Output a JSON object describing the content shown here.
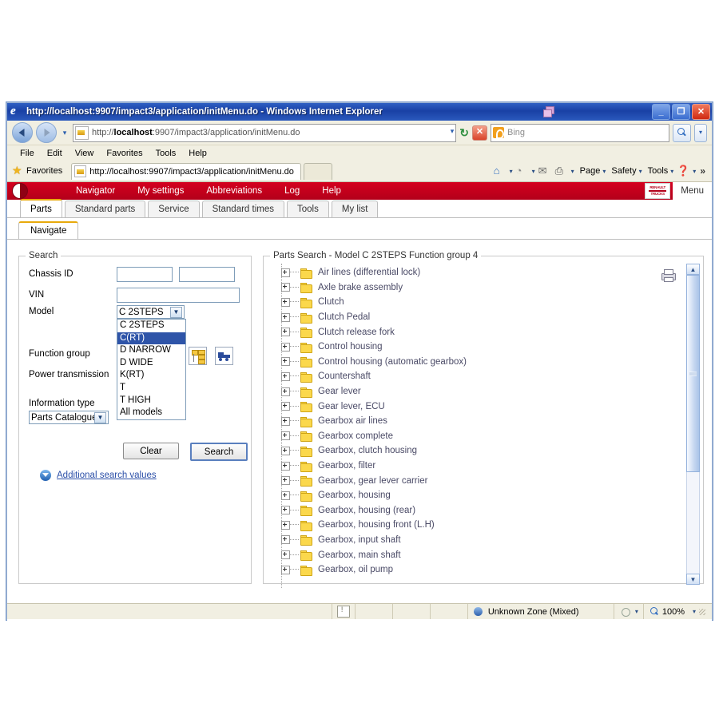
{
  "window": {
    "title": "http://localhost:9907/impact3/application/initMenu.do - Windows Internet Explorer",
    "minimize_label": "_",
    "restore_label": "❐",
    "close_label": "✕"
  },
  "address_bar": {
    "url_prefix": "http://",
    "url_host": "localhost",
    "url_rest": ":9907/impact3/application/initMenu.do",
    "dropdown_caret": "▾",
    "refresh_label": "↻",
    "stop_label": "✕",
    "search_placeholder": "Bing",
    "go_caret": "▾"
  },
  "menu_bar": {
    "items": [
      "File",
      "Edit",
      "View",
      "Favorites",
      "Tools",
      "Help"
    ]
  },
  "favorites_bar": {
    "favorites_label": "Favorites",
    "tab_title": "http://localhost:9907/impact3/application/initMenu.do",
    "right_items": [
      {
        "name": "home-icon",
        "glyph": "⌂",
        "caret": "▾",
        "label": ""
      },
      {
        "name": "feeds-icon",
        "glyph": "◔",
        "caret": "▾",
        "label": ""
      },
      {
        "name": "mail-icon",
        "glyph": "✉",
        "caret": "",
        "label": ""
      },
      {
        "name": "print-icon",
        "glyph": "⎙",
        "caret": "▾",
        "label": ""
      }
    ],
    "right_menus": [
      "Page",
      "Safety",
      "Tools"
    ],
    "help_caret": "▾",
    "overflow": "»"
  },
  "app_header": {
    "nav_items": [
      "Navigator",
      "My settings",
      "Abbreviations",
      "Log",
      "Help"
    ],
    "brand_line1": "RENAULT",
    "brand_line2": "TRUCKS",
    "menu_label": "Menu",
    "accent_color": "#cc0022"
  },
  "main_tabs": {
    "items": [
      "Parts",
      "Standard parts",
      "Service",
      "Standard times",
      "Tools",
      "My list"
    ],
    "active": "Parts",
    "active_color": "#e8a90c"
  },
  "sub_tabs": {
    "items": [
      "Navigate"
    ],
    "active": "Navigate"
  },
  "search_panel": {
    "legend": "Search",
    "chassis_id_label": "Chassis ID",
    "chassis_id_value_1": "",
    "chassis_id_value_2": "",
    "vin_label": "VIN",
    "vin_value": "",
    "model_label": "Model",
    "model_value": "C 2STEPS",
    "model_options": [
      "C 2STEPS",
      "C(RT)",
      "D NARROW",
      "D WIDE",
      "K(RT)",
      "T",
      "T HIGH",
      "All models"
    ],
    "model_highlighted": "C(RT)",
    "function_group_label": "Function group",
    "power_transmission_label": "Power transmission",
    "information_type_label": "Information type",
    "information_type_value": "Parts Catalogue",
    "clear_button": "Clear",
    "search_button": "Search",
    "additional_link": "Additional search values",
    "tree_icon_name": "function-group-tree-icon",
    "truck_icon_name": "vehicle-picker-icon"
  },
  "results_panel": {
    "legend": "Parts Search - Model C 2STEPS Function group 4",
    "expand_glyph": "+",
    "scroll_up": "▲",
    "scroll_down": "▼",
    "tree_items": [
      "Air lines (differential lock)",
      "Axle brake assembly",
      "Clutch",
      "Clutch Pedal",
      "Clutch release fork",
      "Control housing",
      "Control housing (automatic gearbox)",
      "Countershaft",
      "Gear lever",
      "Gear lever, ECU",
      "Gearbox air lines",
      "Gearbox complete",
      "Gearbox, clutch housing",
      "Gearbox, filter",
      "Gearbox, gear lever carrier",
      "Gearbox, housing",
      "Gearbox, housing (rear)",
      "Gearbox, housing front (L.H)",
      "Gearbox, input shaft",
      "Gearbox, main shaft",
      "Gearbox, oil pump"
    ]
  },
  "status_bar": {
    "zone_label": "Unknown Zone (Mixed)",
    "zoom_label": "100%",
    "zoom_caret": "▾",
    "protected_caret": "▾"
  }
}
